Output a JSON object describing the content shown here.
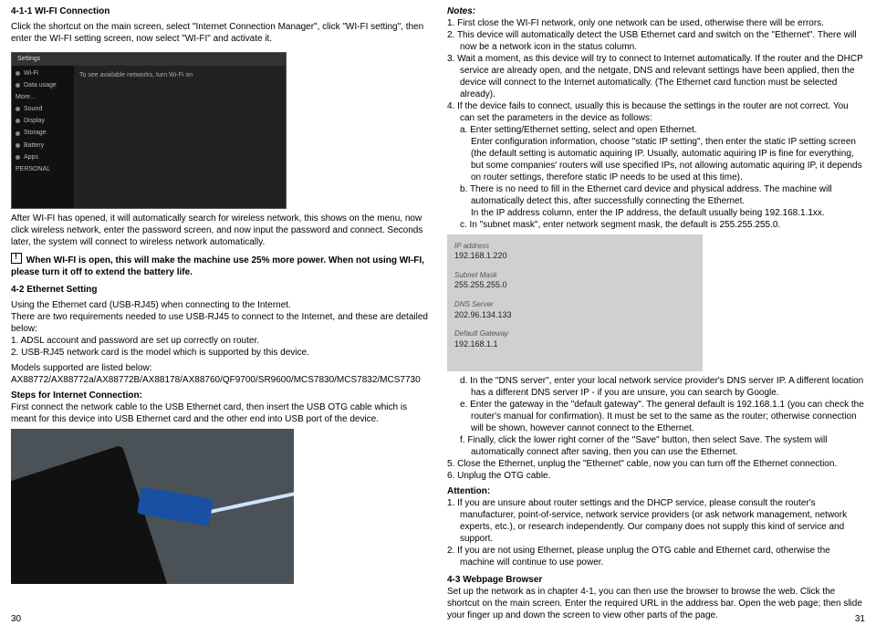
{
  "left": {
    "sec411_title": "4-1-1 WI-FI Connection",
    "sec411_p1": "Click the shortcut on the main screen, select \"Internet Connection Manager\", click \"WI-FI setting\", then enter the WI-FI setting screen, now select \"WI-FI\" and activate it.",
    "settings_img": {
      "top": "Settings",
      "rows": [
        "Wi-Fi",
        "Data usage",
        "More...",
        "Sound",
        "Display",
        "Storage",
        "Battery",
        "Apps",
        "PERSONAL"
      ],
      "main_txt": "To see available networks, turn Wi-Fi on"
    },
    "p_after1": "After WI-FI has opened, it will automatically search for wireless network, this shows on the menu, now click wireless network, enter the password screen, and now input the password and connect. Seconds later, the system will connect to wireless network automatically.",
    "warn_bold": "When WI-FI is open, this will make the machine use 25% more power. When not using WI-FI, please turn it off to extend the battery life.",
    "sec42_title": "4-2 Ethernet Setting",
    "sec42_p1": "Using the Ethernet card (USB-RJ45) when connecting to the Internet.",
    "sec42_p2": "There are two requirements needed to use USB-RJ45 to connect to the Internet, and these are detailed below:",
    "sec42_l1": "1. ADSL account and password are set up correctly on router.",
    "sec42_l2": "2. USB-RJ45 network card is the model which is supported by this device.",
    "models_p1": "Models supported are listed below:",
    "models_p2": "AX88772/AX88772a/AX88772B/AX88178/AX88760/QF9700/SR9600/MCS7830/MCS7832/MCS7730",
    "steps_title": "Steps for Internet Connection:",
    "steps_p1": "First connect the network cable to the USB Ethernet card, then insert the USB OTG cable which is meant for this device into USB Ethernet card and the other end into USB port of the device.",
    "pagenum": "30"
  },
  "right": {
    "notes_title": "Notes:",
    "n1": "1. First close the WI-FI network, only one network can be used, otherwise there will be errors.",
    "n2": "2. This device will automatically detect the USB Ethernet card and switch on the \"Ethernet\". There will now be a network icon in the status column.",
    "n3": "3. Wait a moment, as this device will try to connect to Internet automatically. If the router and the DHCP service are already open, and the netgate, DNS and relevant settings have been applied, then the device will connect to the Internet automatically. (The Ethernet card function must be selected already).",
    "n4": "4. If the device fails to connect, usually this is because the settings in the router are not correct. You can set the parameters in the device as follows:",
    "n4a": "a. Enter setting/Ethernet setting, select and open Ethernet.",
    "n4a2": "Enter configuration information, choose \"static IP setting\", then enter the static IP setting screen (the default setting is automatic aquiring IP. Usually, automatic aquiring IP is fine for everything, but some companies' routers will use specified IPs, not allowing automatic aquiring IP, it depends on router settings, therefore static IP needs to be used at this time).",
    "n4b": "b. There is no need to fill in the Ethernet card device and physical address. The machine will automatically detect this, after successfully connecting the Ethernet.",
    "n4b2": "In the IP address column, enter the IP address, the default usually being 192.168.1.1xx.",
    "n4c": "c. In \"subnet mask\", enter network segment mask, the default is 255.255.255.0.",
    "ip_img": {
      "ip_lbl": "IP address",
      "ip_val": "192.168.1.220",
      "mask_lbl": "Subnet Mask",
      "mask_val": "255.255.255.0",
      "dns_lbl": "DNS Server",
      "dns_val": "202.96.134.133",
      "gw_lbl": "Default Gateway",
      "gw_val": "192.168.1.1"
    },
    "n4d": "d. In the \"DNS server\", enter your local network service provider's DNS server IP. A different location has a different DNS server IP - if you are unsure, you can search by Google.",
    "n4e": "e. Enter the gateway in the \"default gateway\". The general default is 192.168.1.1 (you can check the router's manual for confirmation). It must be set to the same as the router; otherwise connection will be shown, however cannot connect to the Ethernet.",
    "n4f": "f.  Finally, click the lower right corner of the \"Save\" button, then select Save. The system will automatically connect after saving, then you can use the Ethernet.",
    "n5": "5. Close the Ethernet, unplug the \"Ethernet\" cable, now you can turn off the Ethernet connection.",
    "n6": "6. Unplug the OTG cable.",
    "attn_title": "Attention:",
    "a1": "1. If you are unsure about router settings and the DHCP service, please consult the router's manufacturer, point-of-service, network service providers (or ask network management, network experts, etc.), or research independently. Our company does not supply this kind of service and support.",
    "a2": "2. If you are not using Ethernet, please unplug the OTG cable and Ethernet card, otherwise the machine will continue to use power.",
    "sec43_title": "4-3 Webpage Browser",
    "sec43_p1": "Set up the network as in chapter 4-1, you can then use the browser to browse the web. Click the shortcut on the main screen. Enter the required URL in the address bar. Open the web page; then slide your finger up and down the screen to view other parts of the page.",
    "pagenum": "31"
  }
}
